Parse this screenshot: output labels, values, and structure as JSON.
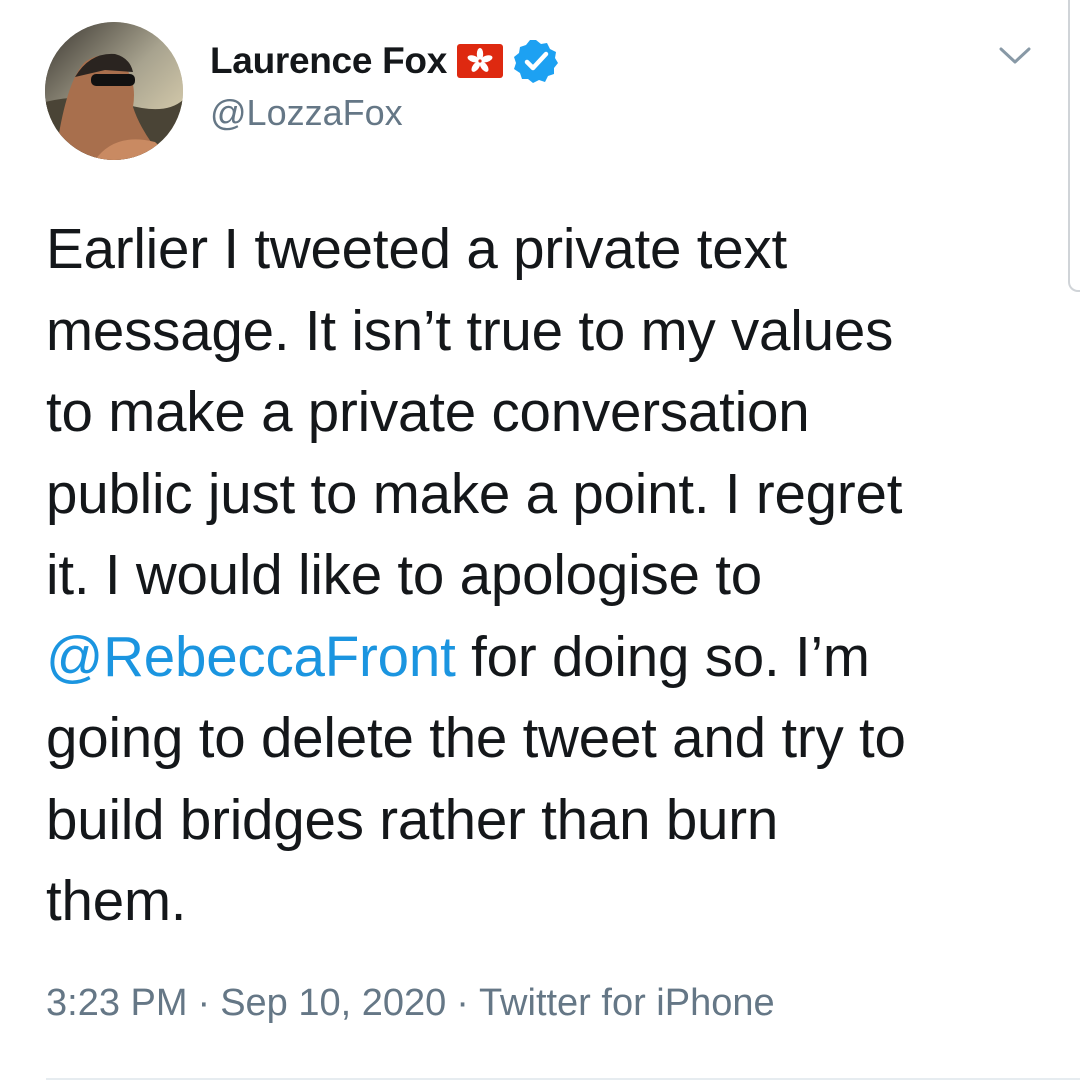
{
  "author": {
    "display_name": "Laurence Fox",
    "handle": "@LozzaFox",
    "flag_icon": "hong-kong-flag-icon",
    "verified_icon": "verified-badge-icon",
    "avatar": "profile-photo"
  },
  "tweet": {
    "lines": [
      "Earlier I tweeted a private text",
      "message. It isn’t true to my values",
      "to make a private conversation",
      "public just to make a point. I regret",
      "it. I would like to apologise to"
    ],
    "mention": "@RebeccaFront",
    "mention_line_rest": " for doing so. I’m",
    "lines_after": [
      "going to delete the tweet and try to",
      "build bridges rather than burn",
      "them."
    ]
  },
  "meta": {
    "time": "3:23 PM",
    "separator": "·",
    "date": "Sep 10, 2020",
    "source": "Twitter for iPhone"
  },
  "colors": {
    "text": "#14171a",
    "secondary": "#657786",
    "link": "#1b95e0",
    "verified": "#1da1f2",
    "flag": "#de2910"
  }
}
